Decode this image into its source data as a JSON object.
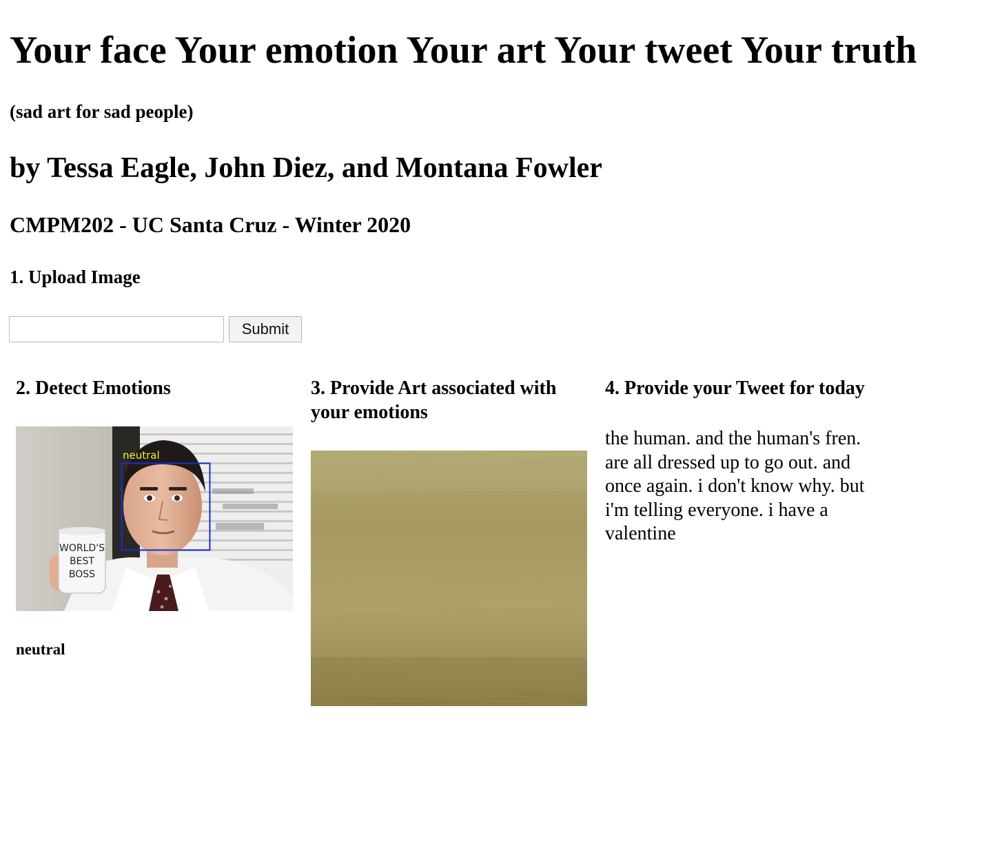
{
  "header": {
    "title": "Your face Your emotion Your art Your tweet Your truth",
    "subtitle": "(sad art for sad people)",
    "authors": "by Tessa Eagle, John Diez, and Montana Fowler",
    "course": "CMPM202 - UC Santa Cruz - Winter 2020"
  },
  "upload": {
    "heading": "1. Upload Image",
    "input_value": "",
    "submit_label": "Submit"
  },
  "detect": {
    "heading": "2. Detect Emotions",
    "face_label": "neutral",
    "mug_text": [
      "WORLD'S",
      "BEST",
      "BOSS"
    ],
    "result": "neutral",
    "box_color": "#1a2fd0",
    "label_color": "#f2f230"
  },
  "art": {
    "heading": "3. Provide Art associated with your emotions",
    "base_color": "#a69a5e"
  },
  "tweet": {
    "heading": "4. Provide your Tweet for today",
    "text": "the human. and the human's fren. are all dressed up to go out. and once again. i don't know why. but i'm telling everyone. i have a valentine"
  }
}
